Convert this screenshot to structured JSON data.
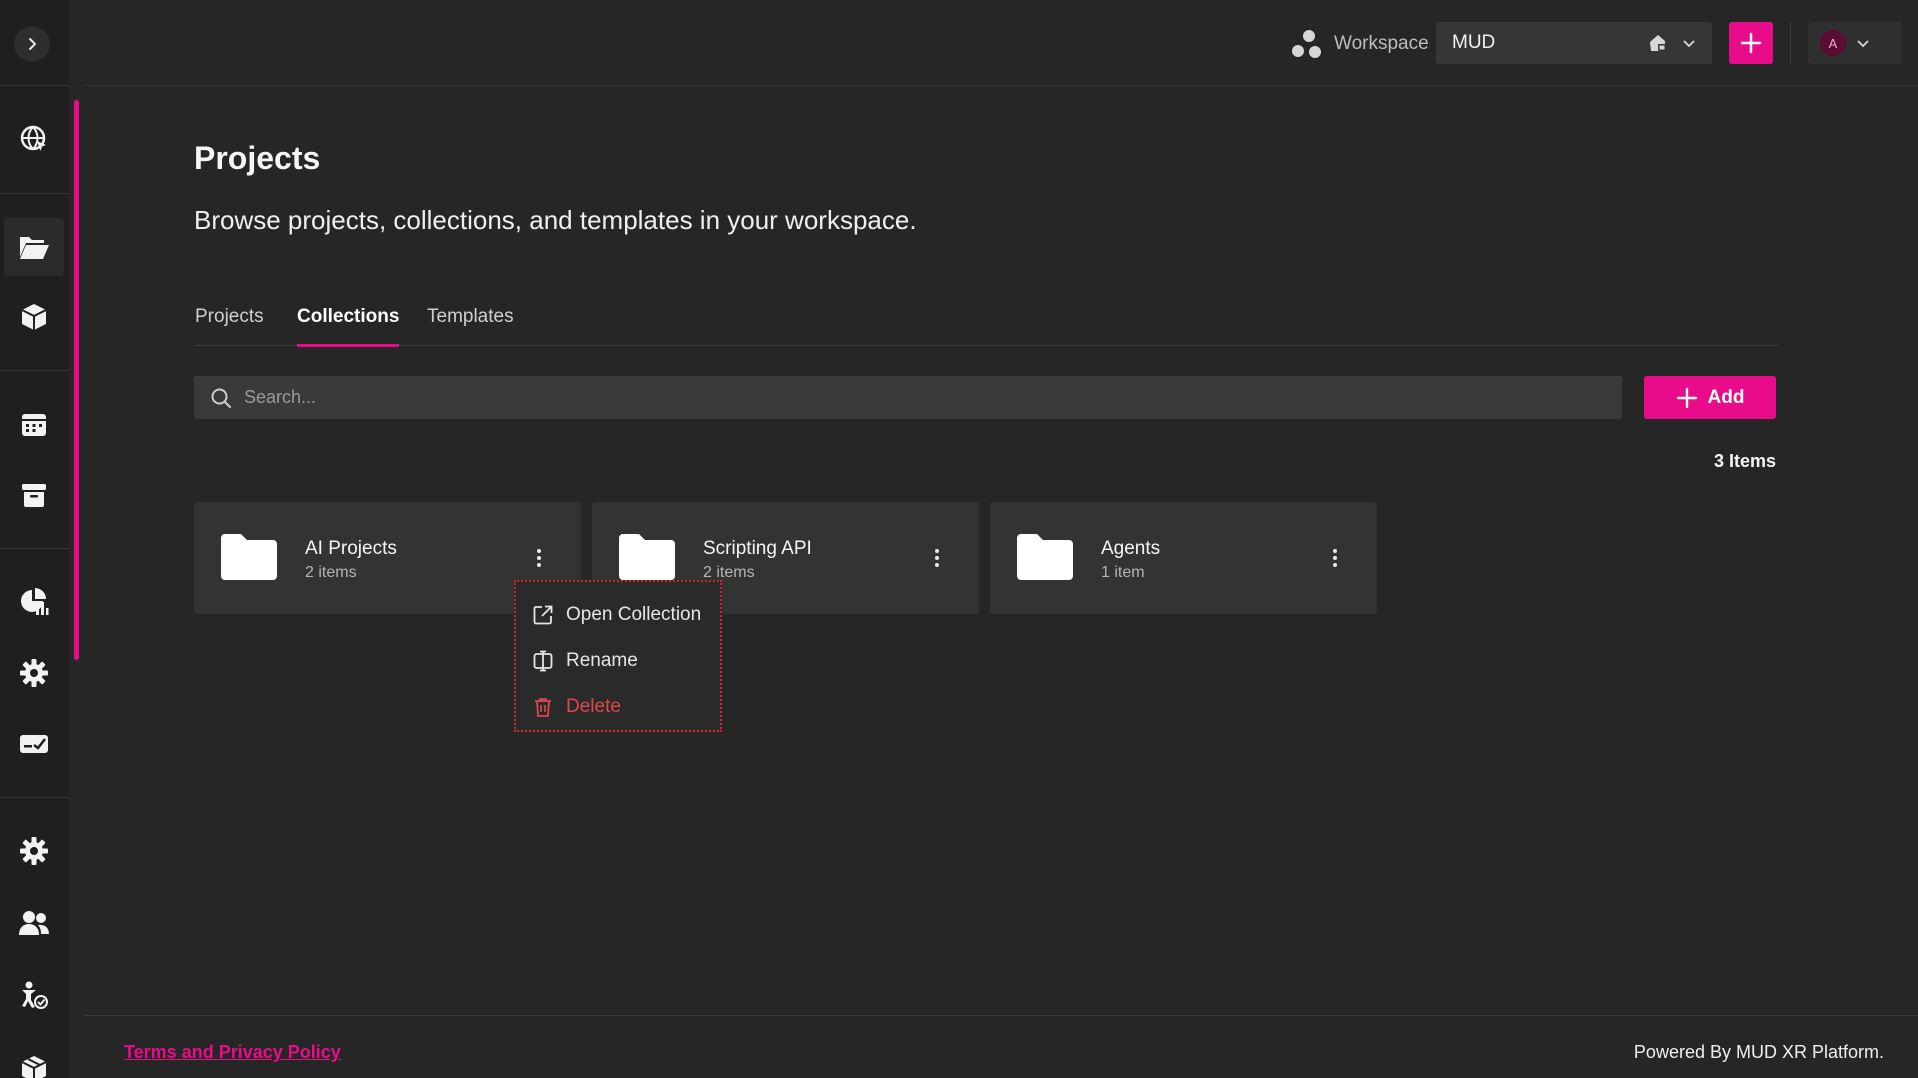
{
  "topbar": {
    "workspace_label": "Workspace",
    "workspace_value": "MUD",
    "user_initial": "A"
  },
  "sidebar": {
    "items": [
      {
        "icon": "globe-cursor-icon"
      },
      {
        "icon": "folder-open-icon",
        "active": true
      },
      {
        "icon": "cube-icon"
      },
      {
        "icon": "calendar-icon"
      },
      {
        "icon": "archive-icon"
      },
      {
        "icon": "analytics-icon"
      },
      {
        "icon": "gear-icon"
      },
      {
        "icon": "card-check-icon"
      },
      {
        "icon": "settings-icon"
      },
      {
        "icon": "users-icon"
      },
      {
        "icon": "person-check-icon"
      },
      {
        "icon": "package-icon"
      }
    ]
  },
  "page": {
    "title": "Projects",
    "subtitle": "Browse projects, collections, and templates in your workspace."
  },
  "tabs": [
    {
      "label": "Projects"
    },
    {
      "label": "Collections",
      "active": true
    },
    {
      "label": "Templates"
    }
  ],
  "search": {
    "placeholder": "Search...",
    "value": ""
  },
  "add_button": {
    "label": "Add"
  },
  "items_count": "3 Items",
  "collections": [
    {
      "name": "AI Projects",
      "count": "2 items"
    },
    {
      "name": "Scripting API",
      "count": "2 items"
    },
    {
      "name": "Agents",
      "count": "1 item"
    }
  ],
  "context_menu": {
    "items": [
      {
        "label": "Open Collection",
        "icon": "external-link-icon"
      },
      {
        "label": "Rename",
        "icon": "rename-icon"
      },
      {
        "label": "Delete",
        "icon": "trash-icon"
      }
    ]
  },
  "footer": {
    "link": "Terms and Privacy Policy",
    "powered_by": "Powered By MUD XR Platform."
  },
  "colors": {
    "accent": "#e90c8a",
    "background": "#262626",
    "sidebar": "#1f1f1f",
    "card": "#333333",
    "danger": "#e0464b"
  }
}
